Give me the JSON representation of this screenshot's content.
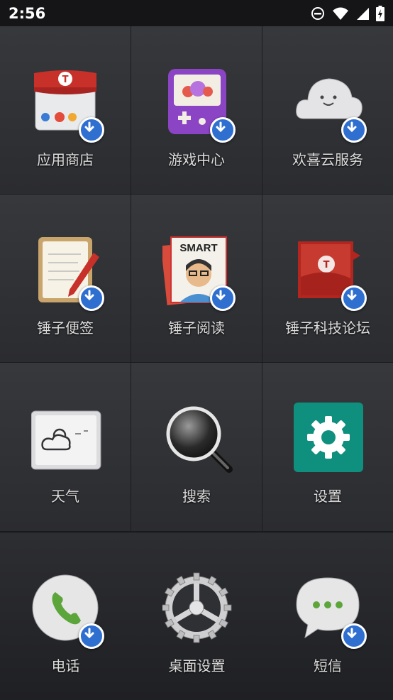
{
  "status_bar": {
    "time": "2:56",
    "icons": [
      "do-not-disturb-icon",
      "wifi-icon",
      "signal-icon",
      "battery-charging-icon"
    ]
  },
  "apps": [
    {
      "label": "应用商店",
      "icon": "app-store-icon",
      "download_badge": true
    },
    {
      "label": "游戏中心",
      "icon": "game-center-icon",
      "download_badge": true
    },
    {
      "label": "欢喜云服务",
      "icon": "cloud-service-icon",
      "download_badge": true
    },
    {
      "label": "锤子便签",
      "icon": "notes-icon",
      "download_badge": true
    },
    {
      "label": "锤子阅读",
      "icon": "reading-icon",
      "download_badge": true,
      "cover_text": "SMART"
    },
    {
      "label": "锤子科技论坛",
      "icon": "forum-icon",
      "download_badge": true
    },
    {
      "label": "天气",
      "icon": "weather-icon",
      "download_badge": false
    },
    {
      "label": "搜索",
      "icon": "search-icon",
      "download_badge": false
    },
    {
      "label": "设置",
      "icon": "settings-icon",
      "download_badge": false
    }
  ],
  "dock": [
    {
      "label": "电话",
      "icon": "phone-icon",
      "download_badge": true
    },
    {
      "label": "桌面设置",
      "icon": "desktop-settings-icon",
      "download_badge": false
    },
    {
      "label": "短信",
      "icon": "sms-icon",
      "download_badge": true
    }
  ],
  "colors": {
    "badge": "#2f6fd0",
    "settings_tile": "#0f8f7e",
    "phone_green": "#5ca53a",
    "store_red": "#c8302a",
    "game_purple": "#8a44c4"
  }
}
